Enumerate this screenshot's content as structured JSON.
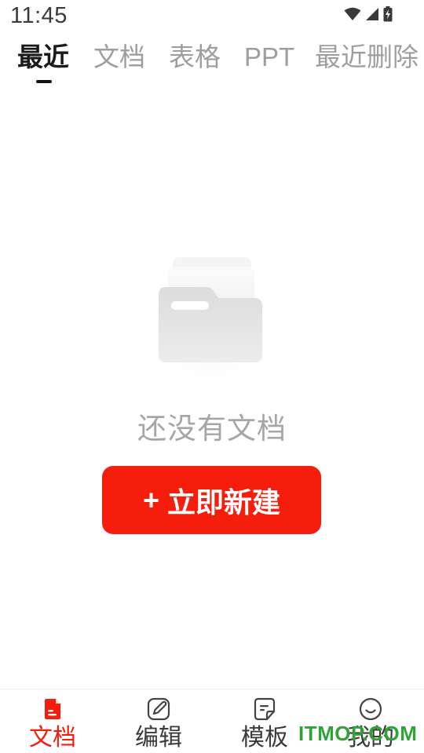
{
  "status_bar": {
    "time": "11:45",
    "icons": [
      "wifi-icon",
      "signal-icon",
      "battery-icon"
    ]
  },
  "tabs": [
    {
      "label": "最近",
      "active": true
    },
    {
      "label": "文档",
      "active": false
    },
    {
      "label": "表格",
      "active": false
    },
    {
      "label": "PPT",
      "active": false
    },
    {
      "label": "最近删除",
      "active": false
    }
  ],
  "empty_state": {
    "icon": "folder-illustration",
    "message": "还没有文档",
    "button_plus": "+",
    "button_label": "立即新建"
  },
  "bottom_nav": [
    {
      "label": "文档",
      "icon": "document-icon",
      "active": true
    },
    {
      "label": "编辑",
      "icon": "edit-icon",
      "active": false
    },
    {
      "label": "模板",
      "icon": "template-icon",
      "active": false
    },
    {
      "label": "我的",
      "icon": "profile-icon",
      "active": false
    }
  ],
  "watermark": "ITMOP.COM",
  "colors": {
    "accent": "#f51e0c",
    "inactive_text": "#9e9e9e",
    "watermark": "#2fa336"
  }
}
